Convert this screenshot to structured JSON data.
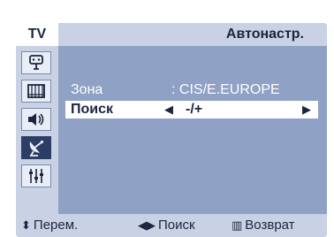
{
  "header": {
    "tv_tab": "TV",
    "title": "Автонастр."
  },
  "sidebar": {
    "items": [
      {
        "icon": "antenna-plug-icon"
      },
      {
        "icon": "screen-grid-icon"
      },
      {
        "icon": "speaker-icon"
      },
      {
        "icon": "satellite-dish-icon",
        "active": true
      },
      {
        "icon": "equalizer-sliders-icon"
      }
    ]
  },
  "menu": {
    "rows": [
      {
        "label": "Зона",
        "value": ": CIS/E.EUROPE"
      },
      {
        "label": "Поиск",
        "value": "-/+"
      }
    ]
  },
  "status": {
    "move_label": "Перем.",
    "search_label": "Поиск",
    "return_label": "Возврат"
  }
}
